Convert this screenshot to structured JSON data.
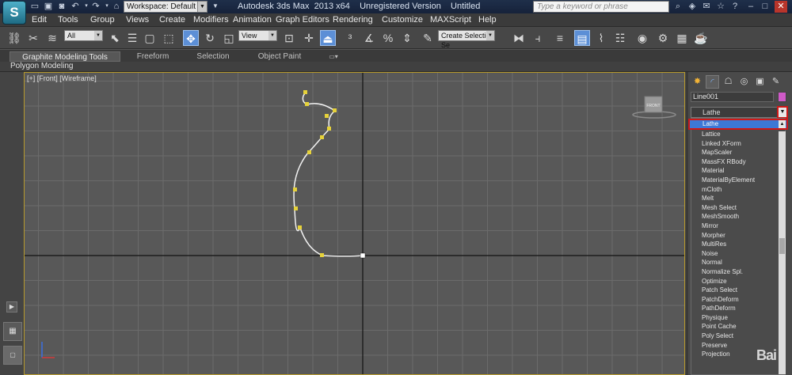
{
  "titlebar": {
    "workspace": "Workspace: Default",
    "title": "Autodesk 3ds Max  2013 x64    Unregistered Version    Untitled",
    "search_placeholder": "Type a keyword or phrase"
  },
  "menu": [
    "Edit",
    "Tools",
    "Group",
    "Views",
    "Create",
    "Modifiers",
    "Animation",
    "Graph Editors",
    "Rendering",
    "Customize",
    "MAXScript",
    "Help"
  ],
  "toolbar": {
    "filter": "All",
    "ref_coord": "View",
    "selection_set": "Create Selection Se"
  },
  "ribbon": {
    "tabs": [
      "Graphite Modeling Tools",
      "Freeform",
      "Selection",
      "Object Paint"
    ],
    "panel_label": "Polygon Modeling"
  },
  "viewport": {
    "label": "[+] [Front] [Wireframe]",
    "viewcube_label": "FRONT"
  },
  "command_panel": {
    "object_name": "Line001",
    "object_color": "#cf5ac8",
    "modifier_combo": "Lathe",
    "selected_modifier": "Lathe",
    "modifiers": [
      "Lattice",
      "Linked XForm",
      "MapScaler",
      "MassFX RBody",
      "Material",
      "MaterialByElement",
      "mCloth",
      "Melt",
      "Mesh Select",
      "MeshSmooth",
      "Mirror",
      "Morpher",
      "MultiRes",
      "Noise",
      "Normal",
      "Normalize Spl.",
      "Optimize",
      "Patch Select",
      "PatchDeform",
      "PathDeform",
      "Physique",
      "Point Cache",
      "Poly Select",
      "Preserve",
      "Projection"
    ]
  },
  "watermark": "Baidu"
}
